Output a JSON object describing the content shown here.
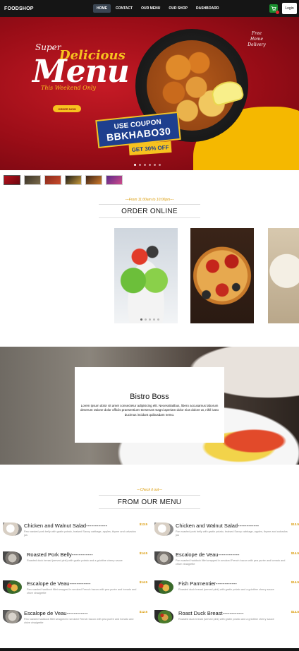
{
  "nav": {
    "brand": "FOODSHOP",
    "links": [
      "HOME",
      "CONTACT",
      "OUR MENU",
      "OUR SHOP",
      "DASHBOARD"
    ],
    "login": "Login"
  },
  "hero": {
    "super": "Super",
    "delicious": "Delicious",
    "menu": "Menu",
    "weekend": "This Weekend Only",
    "order_now": "ORDER NOW",
    "free_delivery": "Free Home Delivery",
    "coupon_label": "USE COUPON",
    "coupon_code": "BBKHABO30",
    "discount": "GET 30% OFF"
  },
  "order_online": {
    "subtitle": "---From 11:00am to 10:00pm---",
    "title": "ORDER ONLINE"
  },
  "bistro": {
    "title": "Bistro Boss",
    "text": "Lorem ipsum dolor sit amet consectetur adipisicing elit. Necessitatibus, libero accusamus laborum deserunt ratione dolor officiis praesentium! Deserunt magni aperiam dolor eius dolore at, nihil iusto ducimus incidunt quibusdam nemo."
  },
  "our_menu": {
    "subtitle": "---Check it out---",
    "title": "FROM OUR MENU"
  },
  "menu_items": [
    {
      "name": "Chicken and Walnut Salad------------",
      "price": "$13.5",
      "desc": "Pan roasted pork belly with gratin potato, braised Savoy cabbage, apples, thyme and calvados jus"
    },
    {
      "name": "Chicken and Walnut Salad------------",
      "price": "$13.5",
      "desc": "Pan roasted pork belly with gratin potato, braised Savoy cabbage, apples, thyme and calvados jus"
    },
    {
      "name": "Roasted Pork Belly------------",
      "price": "$14.5",
      "desc": "Roasted duck breast (served pink) with gratin potato and a griottine cherry sauce"
    },
    {
      "name": "Escalope de Veau------------",
      "price": "$14.5",
      "desc": "Pan roasted haddock fillet wrapped in smoked French bacon with pea purée and tomato and chive vinaigrette"
    },
    {
      "name": "Escalope de Veau------------",
      "price": "$14.5",
      "desc": "Pan roasted haddock fillet wrapped in smoked French bacon with pea purée and tomato and chive vinaigrette"
    },
    {
      "name": "Fish Parmentier------------",
      "price": "$14.5",
      "desc": "Roasted duck breast (served pink) with gratin potato and a griottine cherry sauce"
    },
    {
      "name": "Escalope de Veau------------",
      "price": "$12.5",
      "desc": "Pan roasted haddock fillet wrapped in smoked French bacon with pea purée and tomato and chive vinaigrette"
    },
    {
      "name": "Roast Duck Breast------------",
      "price": "$14.5",
      "desc": "Roasted duck breast (served pink) with gratin potato and a griottine cherry sauce"
    }
  ],
  "colors": {
    "accent": "#d99904",
    "nav_bg": "#151515",
    "hero_red": "#b3121c",
    "coupon_blue": "#1e3f8e"
  },
  "icons": {
    "cart": "cart-icon"
  }
}
